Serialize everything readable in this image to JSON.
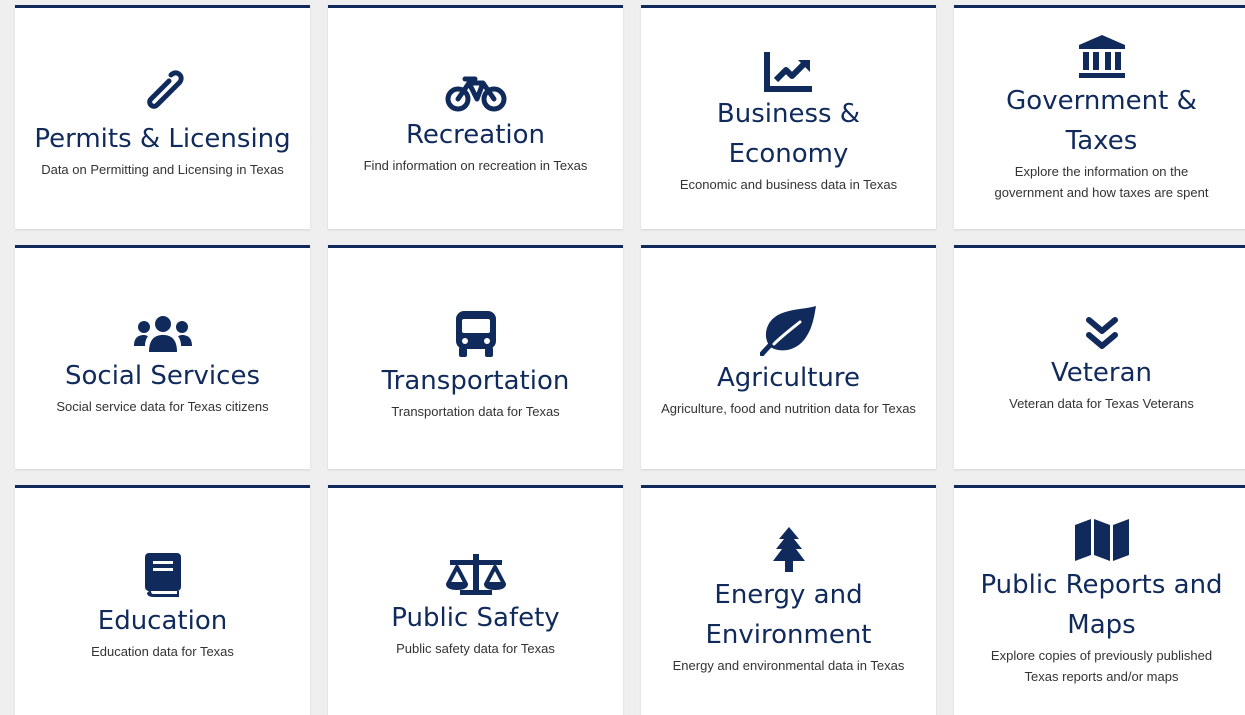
{
  "colors": {
    "accent": "#102a5c",
    "background": "#efefef",
    "card": "#ffffff",
    "text": "#333333"
  },
  "cards": [
    {
      "icon": "paperclip-icon",
      "title": "Permits & Licensing",
      "desc": "Data on Permitting and Licensing in Texas"
    },
    {
      "icon": "bicycle-icon",
      "title": "Recreation",
      "desc": "Find information on recreation in Texas"
    },
    {
      "icon": "chart-line-icon",
      "title": "Business & Economy",
      "desc": "Economic and business data in Texas"
    },
    {
      "icon": "landmark-icon",
      "title": "Government & Taxes",
      "desc": "Explore the information on the government and how taxes are spent"
    },
    {
      "icon": "users-icon",
      "title": "Social Services",
      "desc": "Social service data for Texas citizens"
    },
    {
      "icon": "bus-icon",
      "title": "Transportation",
      "desc": "Transportation data for Texas"
    },
    {
      "icon": "leaf-icon",
      "title": "Agriculture",
      "desc": "Agriculture, food and nutrition data for Texas"
    },
    {
      "icon": "chevron-double-down-icon",
      "title": "Veteran",
      "desc": "Veteran data for Texas Veterans"
    },
    {
      "icon": "book-icon",
      "title": "Education",
      "desc": "Education data for Texas"
    },
    {
      "icon": "balance-scale-icon",
      "title": "Public Safety",
      "desc": "Public safety data for Texas"
    },
    {
      "icon": "tree-icon",
      "title": "Energy and Environment",
      "desc": "Energy and environmental data in Texas"
    },
    {
      "icon": "map-icon",
      "title": "Public Reports and Maps",
      "desc": "Explore copies of previously published Texas reports and/or maps"
    }
  ]
}
